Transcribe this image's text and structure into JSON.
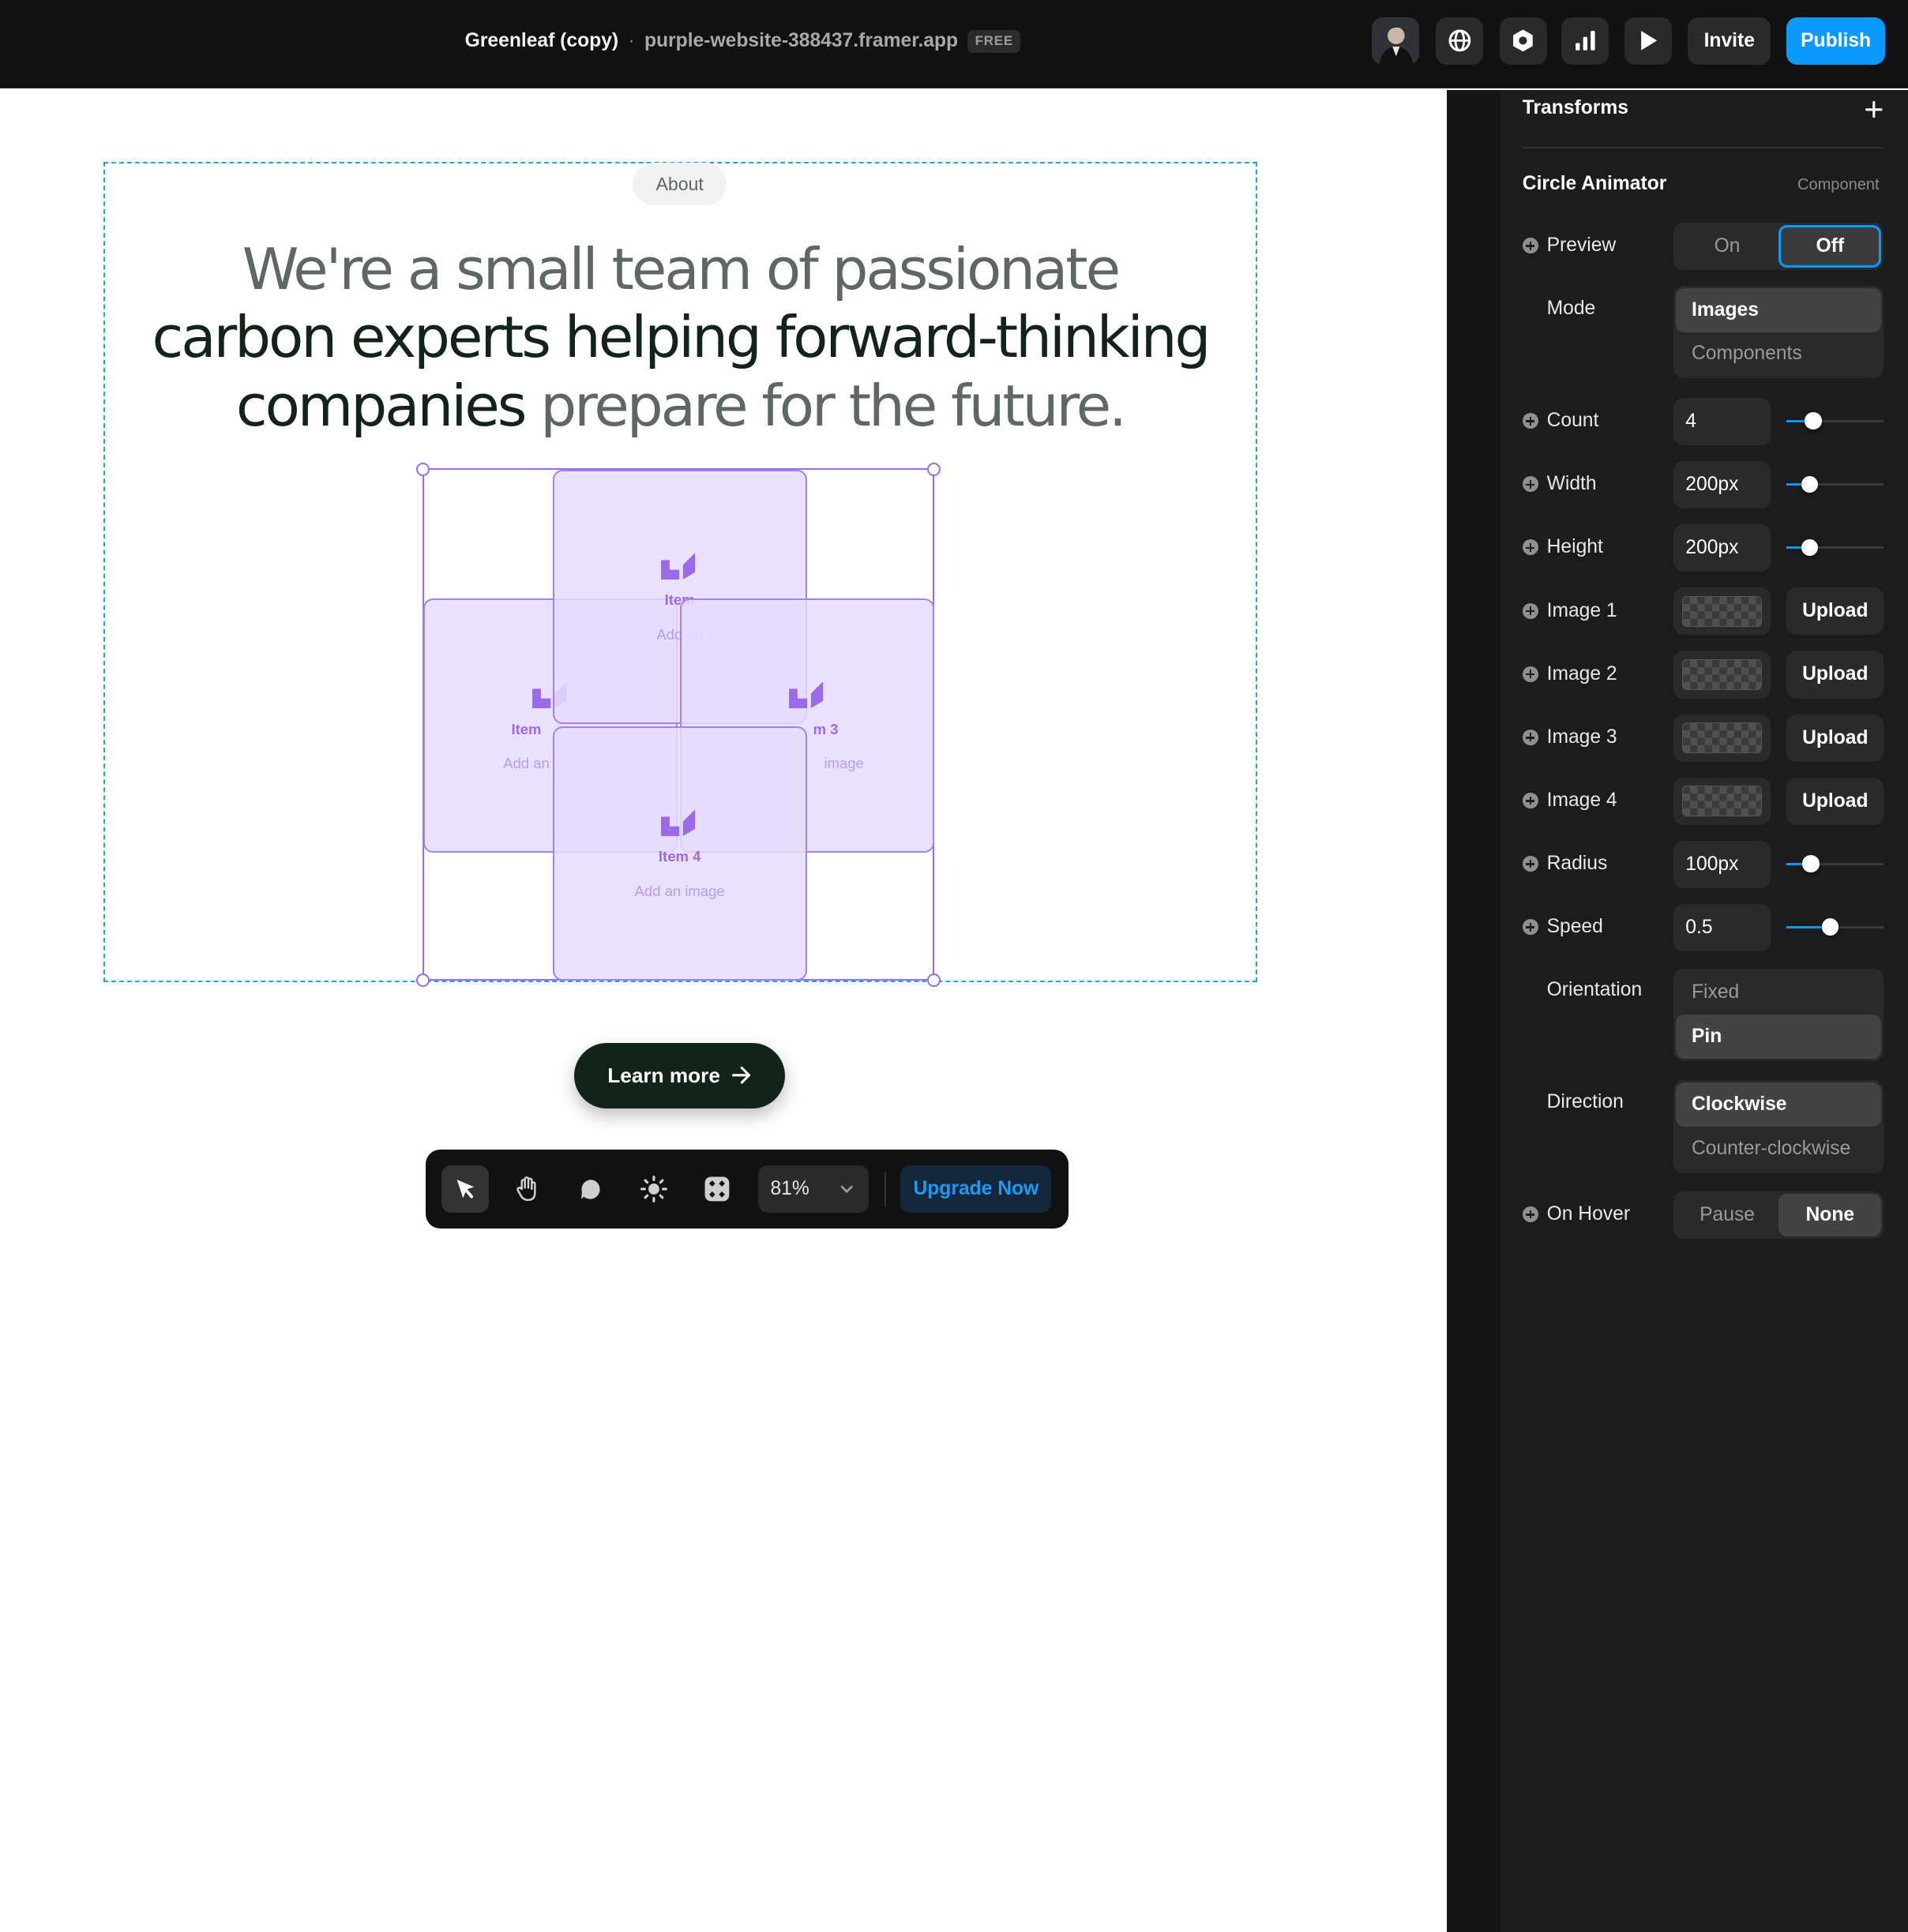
{
  "topbar": {
    "project_name": "Greenleaf (copy)",
    "separator": "·",
    "site_url": "purple-website-388437.framer.app",
    "plan_badge": "FREE",
    "invite_label": "Invite",
    "publish_label": "Publish",
    "icons": [
      "avatar",
      "globe-icon",
      "settings-hex-icon",
      "analytics-icon",
      "play-icon"
    ]
  },
  "canvas": {
    "about_label": "About",
    "headline": {
      "part1": "We're a small team of passionate",
      "part2": "carbon experts helping forward-thinking",
      "part3": "companies",
      "part4": " prepare for the future."
    },
    "items": [
      {
        "label": "Item",
        "hint": "Add an"
      },
      {
        "label": "Item",
        "hint": "Add an"
      },
      {
        "label": "m 3",
        "hint": "image"
      },
      {
        "label": "Item 4",
        "hint": "Add an image"
      }
    ],
    "learn_more": "Learn more",
    "accent_purple": "#9b6cf0",
    "selection_blue": "#1fa3f0"
  },
  "toolbar": {
    "tools": [
      "select-tool",
      "hand-tool",
      "comment-tool",
      "theme-tool",
      "components-tool"
    ],
    "zoom": "81%",
    "upgrade_label": "Upgrade Now"
  },
  "panel": {
    "transforms_title": "Transforms",
    "component_title": "Circle Animator",
    "component_type": "Component",
    "preview": {
      "label": "Preview",
      "options": [
        "On",
        "Off"
      ],
      "selected": "Off"
    },
    "mode": {
      "label": "Mode",
      "options": [
        "Images",
        "Components"
      ],
      "selected": "Images"
    },
    "count": {
      "label": "Count",
      "value": "4",
      "slider": 0.28
    },
    "width": {
      "label": "Width",
      "value": "200px",
      "slider": 0.24
    },
    "height": {
      "label": "Height",
      "value": "200px",
      "slider": 0.24
    },
    "images": [
      {
        "label": "Image 1",
        "button": "Upload"
      },
      {
        "label": "Image 2",
        "button": "Upload"
      },
      {
        "label": "Image 3",
        "button": "Upload"
      },
      {
        "label": "Image 4",
        "button": "Upload"
      }
    ],
    "radius": {
      "label": "Radius",
      "value": "100px",
      "slider": 0.25
    },
    "speed": {
      "label": "Speed",
      "value": "0.5",
      "slider": 0.45
    },
    "orientation": {
      "label": "Orientation",
      "options": [
        "Fixed",
        "Pin"
      ],
      "selected": "Pin"
    },
    "direction": {
      "label": "Direction",
      "options": [
        "Clockwise",
        "Counter-clockwise"
      ],
      "selected": "Clockwise"
    },
    "on_hover": {
      "label": "On Hover",
      "options": [
        "Pause",
        "None"
      ],
      "selected": "None"
    }
  }
}
